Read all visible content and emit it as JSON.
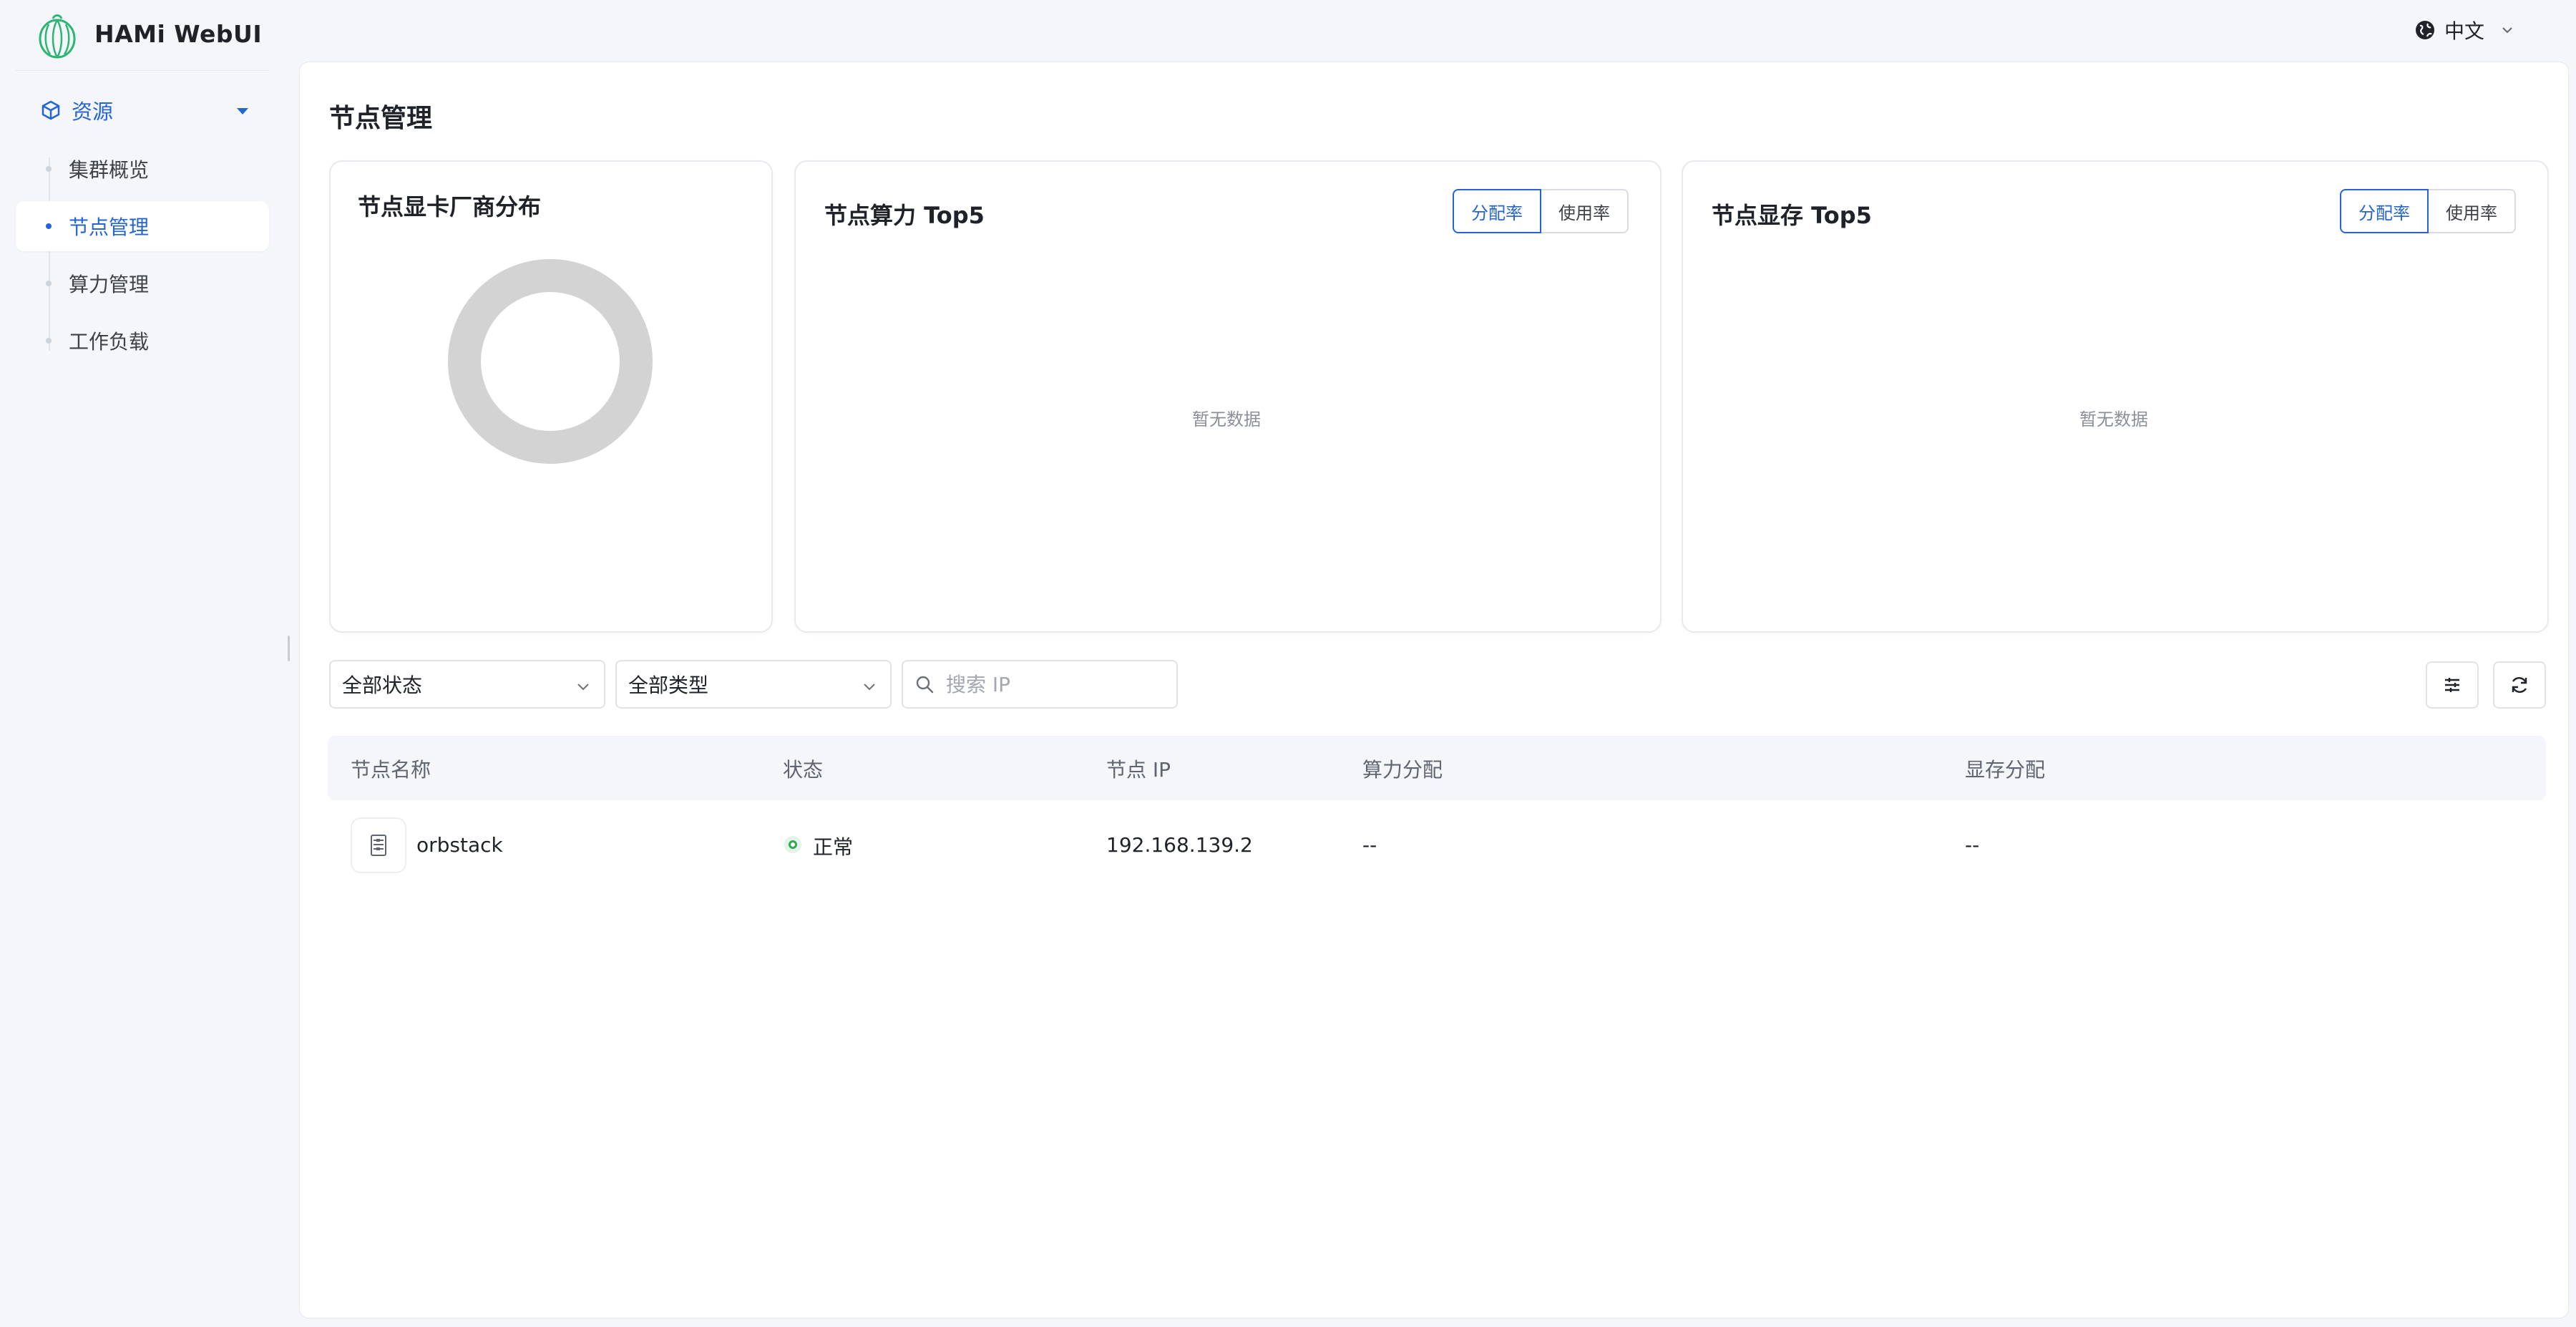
{
  "app": {
    "title": "HAMi WebUI"
  },
  "language": {
    "label": "中文"
  },
  "sidebar": {
    "group_label": "资源",
    "items": [
      {
        "label": "集群概览"
      },
      {
        "label": "节点管理"
      },
      {
        "label": "算力管理"
      },
      {
        "label": "工作负载"
      }
    ]
  },
  "page": {
    "title": "节点管理"
  },
  "cards": {
    "vendor": {
      "title": "节点显卡厂商分布"
    },
    "compute": {
      "title": "节点算力 Top5",
      "tab_alloc": "分配率",
      "tab_usage": "使用率",
      "empty": "暂无数据"
    },
    "memory": {
      "title": "节点显存 Top5",
      "tab_alloc": "分配率",
      "tab_usage": "使用率",
      "empty": "暂无数据"
    }
  },
  "filters": {
    "status": "全部状态",
    "type": "全部类型",
    "search_placeholder": "搜索 IP"
  },
  "table": {
    "columns": [
      "节点名称",
      "状态",
      "节点 IP",
      "算力分配",
      "显存分配"
    ],
    "rows": [
      {
        "name": "orbstack",
        "status": "正常",
        "ip": "192.168.139.2",
        "compute_alloc": "--",
        "memory_alloc": "--"
      }
    ]
  },
  "colors": {
    "accent": "#2464d4",
    "status_ok": "#34a853",
    "donut_empty": "#d3d3d3"
  },
  "icons": {
    "language": "globe-icon",
    "group": "cube-icon",
    "filter_settings": "sliders-icon",
    "refresh": "refresh-icon",
    "search": "search-icon"
  }
}
